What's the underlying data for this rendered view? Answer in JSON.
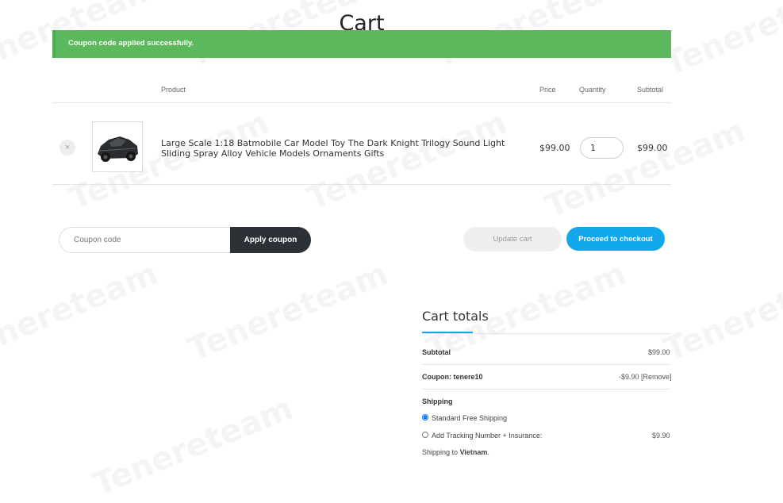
{
  "page": {
    "title": "Cart"
  },
  "notice": {
    "text": "Coupon code applied successfully."
  },
  "table": {
    "headers": {
      "product": "Product",
      "price": "Price",
      "quantity": "Quantity",
      "subtotal": "Subtotal"
    },
    "rows": [
      {
        "name": "Large Scale 1:18 Batmobile Car Model Toy The Dark Knight Trilogy Sound Light Sliding Spray Alloy Vehicle Models Ornaments Gifts",
        "price": "$99.00",
        "quantity": "1",
        "subtotal": "$99.00",
        "remove_symbol": "×"
      }
    ]
  },
  "coupon": {
    "placeholder": "Coupon code",
    "apply_label": "Apply coupon"
  },
  "actions": {
    "update_label": "Update cart",
    "checkout_label": "Proceed to checkout"
  },
  "totals": {
    "title": "Cart totals",
    "subtotal_label": "Subtotal",
    "subtotal_value": "$99.00",
    "coupon_label": "Coupon: tenere10",
    "coupon_value": "-$9.90",
    "coupon_remove": "[Remove]",
    "shipping_label": "Shipping",
    "shipping_options": [
      {
        "label": "Standard Free Shipping",
        "price": "",
        "selected": true
      },
      {
        "label": "Add Tracking Number + Insurance:",
        "price": "$9.90",
        "selected": false
      }
    ],
    "shipping_to_prefix": "Shipping to",
    "shipping_to_country": "Vietnam"
  },
  "watermark": {
    "text": "Tenereteam"
  },
  "colors": {
    "success": "#5cb85c",
    "accent": "#12a6ea",
    "dark_button": "#2b3136"
  }
}
